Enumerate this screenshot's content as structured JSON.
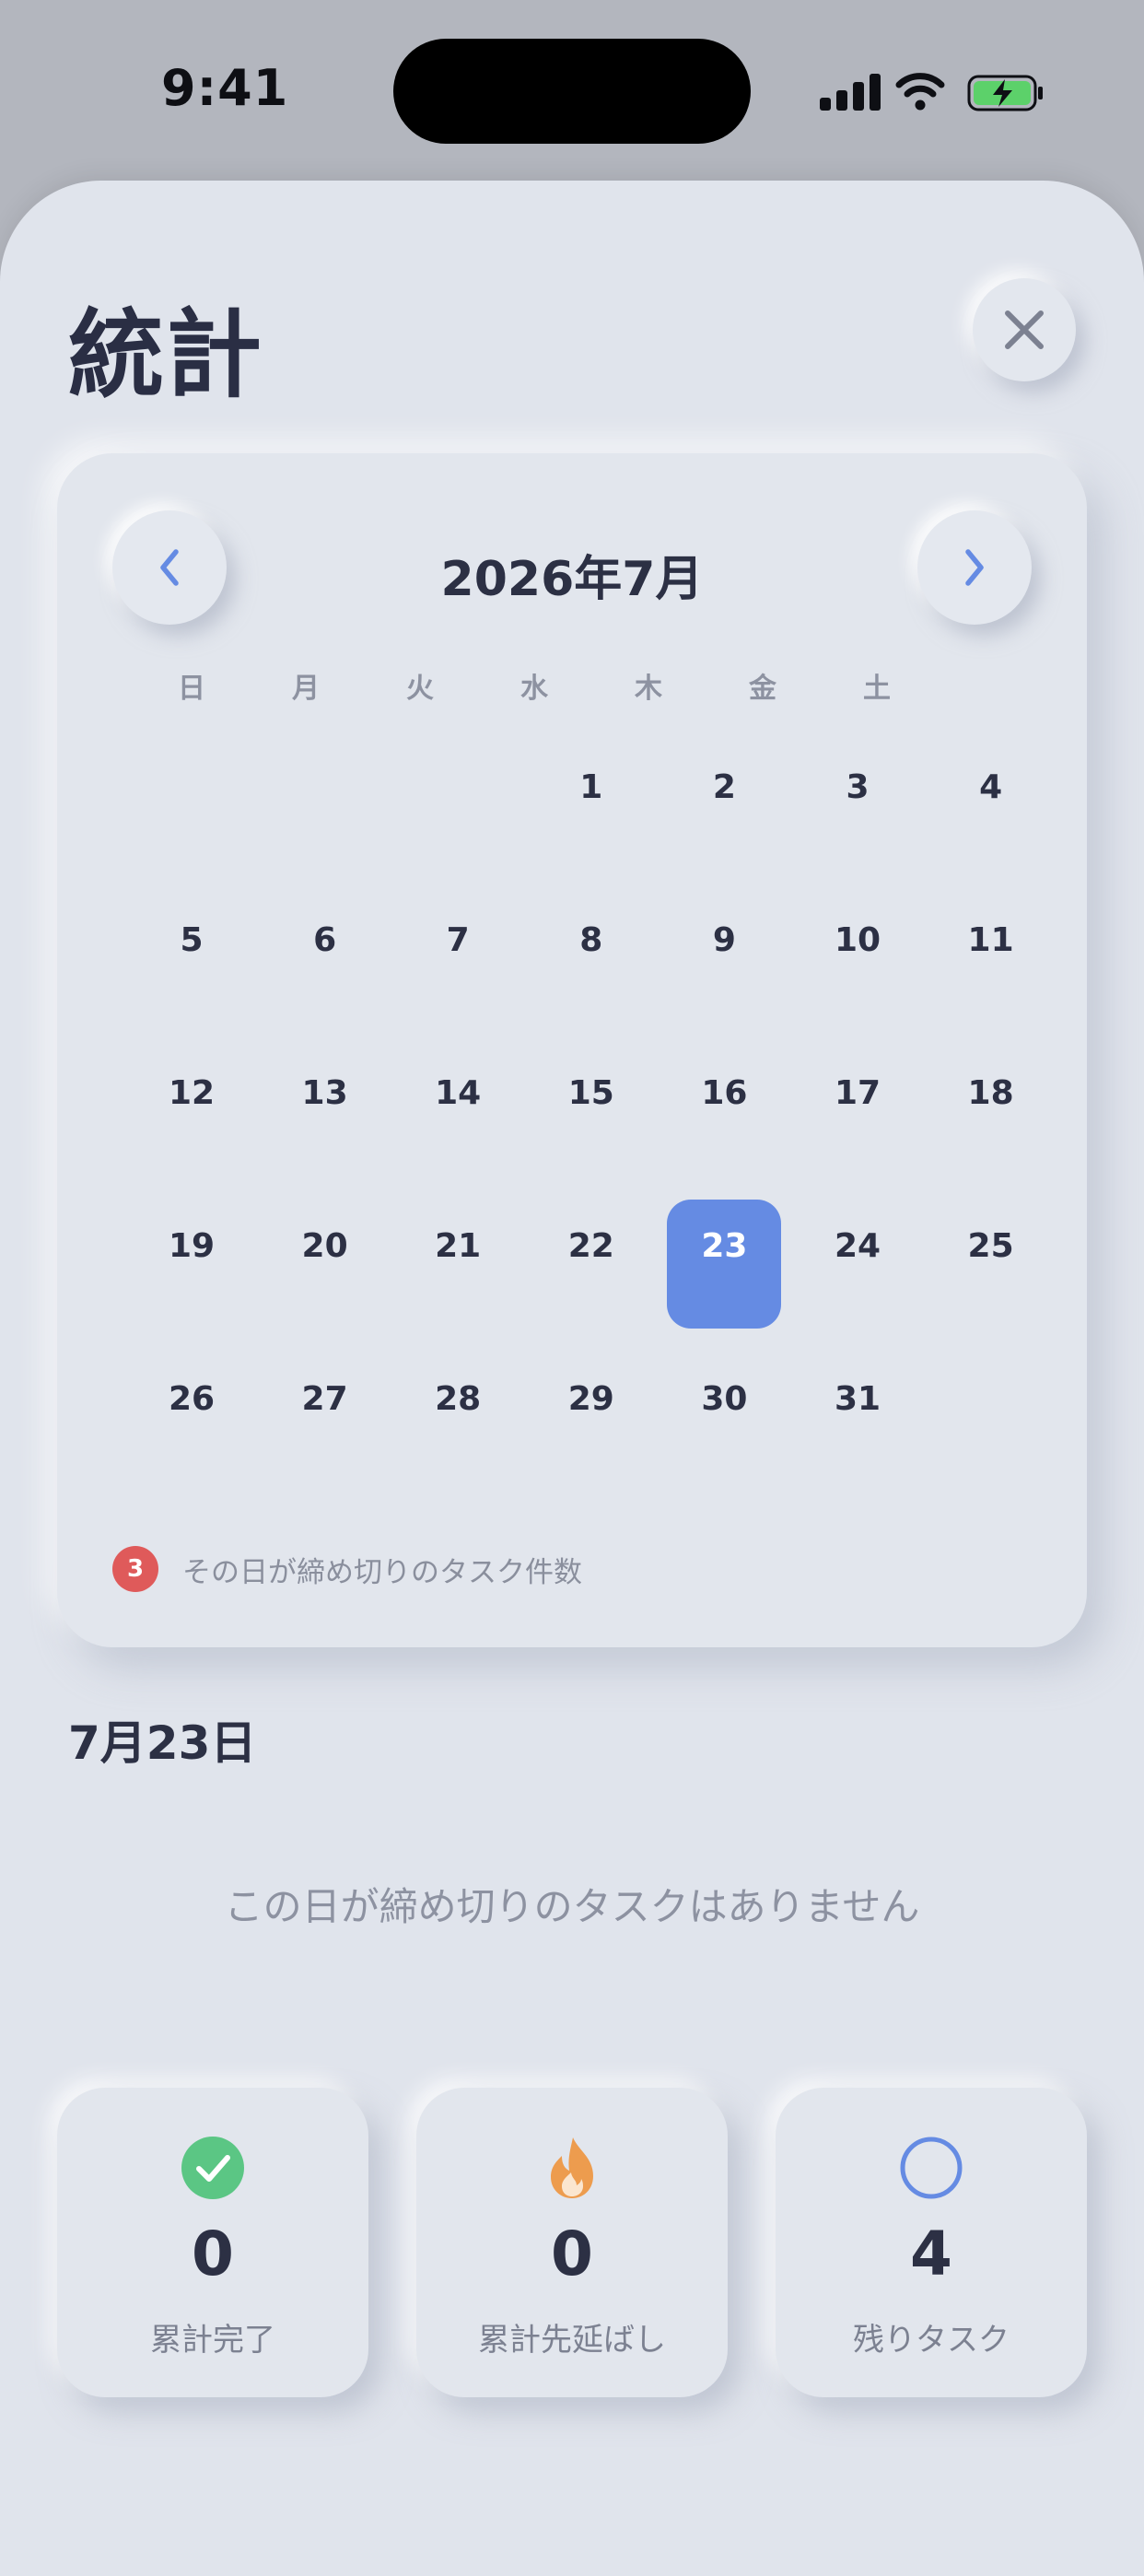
{
  "status_bar": {
    "time": "9:41"
  },
  "header": {
    "title": "統計"
  },
  "calendar": {
    "month_label": "2026年7月",
    "weekdays": [
      "日",
      "月",
      "火",
      "水",
      "木",
      "金",
      "土"
    ],
    "weeks": [
      [
        "",
        "",
        "",
        "1",
        "2",
        "3",
        "4"
      ],
      [
        "5",
        "6",
        "7",
        "8",
        "9",
        "10",
        "11"
      ],
      [
        "12",
        "13",
        "14",
        "15",
        "16",
        "17",
        "18"
      ],
      [
        "19",
        "20",
        "21",
        "22",
        "23",
        "24",
        "25"
      ],
      [
        "26",
        "27",
        "28",
        "29",
        "30",
        "31",
        ""
      ]
    ],
    "selected_day": "23",
    "legend_badge": "3",
    "legend_text": "その日が締め切りのタスク件数"
  },
  "selected_date": {
    "heading": "7月23日",
    "empty_message": "この日が締め切りのタスクはありません"
  },
  "stats": [
    {
      "icon": "checkmark-circle-icon",
      "value": "0",
      "label": "累計完了",
      "color": "#5bc684"
    },
    {
      "icon": "flame-icon",
      "value": "0",
      "label": "累計先延ばし",
      "color": "#ed9c4e"
    },
    {
      "icon": "circle-outline-icon",
      "value": "4",
      "label": "残りタスク",
      "color": "#658be3"
    }
  ],
  "colors": {
    "accent": "#658be3",
    "background": "#e0e4ec",
    "badge": "#df5a5a",
    "text": "#2c3044",
    "muted": "#8d92a1"
  }
}
